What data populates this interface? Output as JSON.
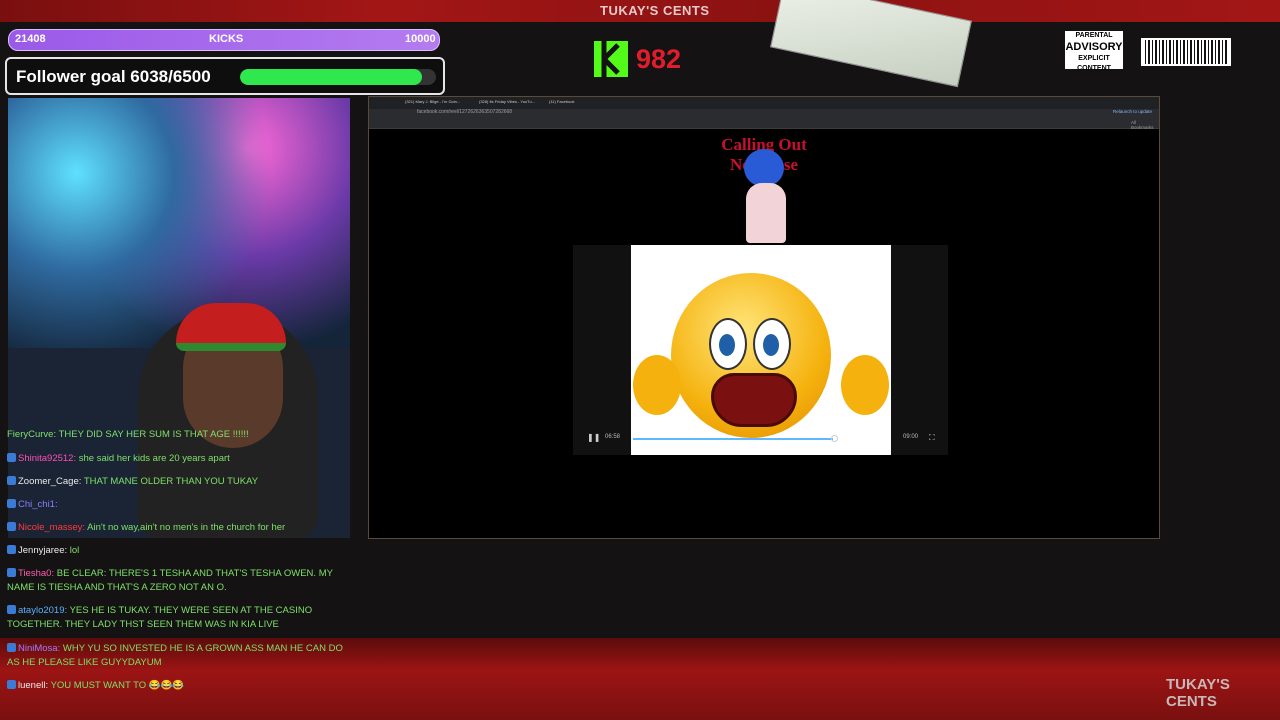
{
  "branding": {
    "top_title": "TUKAY'S CENTS",
    "bottom_title": "TUKAY'S CENTS"
  },
  "kicks_bar": {
    "left_value": "21408",
    "label": "KICKS",
    "right_value": "10000"
  },
  "follower_goal": {
    "text": "Follower goal 6038/6500",
    "progress_fraction": 0.929
  },
  "kick_counter": {
    "count": "982",
    "accent": "#53fc18",
    "count_color": "#e11d2b"
  },
  "advisory": {
    "line1": "PARENTAL",
    "line2": "ADVISORY",
    "line3": "EXPLICIT CONTENT"
  },
  "browser": {
    "tabs": [
      "(321) Mary J. Blige - I'm Goin...",
      "(328) Its Friday Vibes - YouTu...",
      "(11) Facebook"
    ],
    "url": "facebook.com/reel/1272626363507282668",
    "bookmarks_label": "All Bookmarks",
    "update_label": "Relaunch to update"
  },
  "video": {
    "time_current": "06:58",
    "time_total": "09:00",
    "overlay_title": "Calling Out Nonsense"
  },
  "chat": [
    {
      "user": "FieryCurve",
      "user_color": "#7ee06a",
      "text": "THEY DID SAY HER SUM IS THAT AGE !!!!!!",
      "text_color": "#7ee06a"
    },
    {
      "user": "Shinita92512",
      "user_color": "#ff4fb8",
      "text": "she said her kids are 20 years apart",
      "text_color": "#7ee06a"
    },
    {
      "user": "Zoomer_Cage",
      "user_color": "#eaeaea",
      "text": "THAT MANE OLDER THAN YOU TUKAY",
      "text_color": "#7ee06a"
    },
    {
      "user": "Chi_chi1",
      "user_color": "#8a7dff",
      "text": "",
      "text_color": "#eaeaea"
    },
    {
      "user": "Nicole_massey",
      "user_color": "#ff3b3b",
      "text": "Ain't no way,ain't no men's in the church for her",
      "text_color": "#7ee06a"
    },
    {
      "user": "Jennyjaree",
      "user_color": "#eaeaea",
      "text": "lol",
      "text_color": "#7ee06a"
    },
    {
      "user": "Tiesha0",
      "user_color": "#ff5fb0",
      "text": "BE CLEAR: THERE'S 1 TESHA AND THAT'S TESHA OWEN. MY NAME IS TIESHA AND THAT'S A ZERO NOT AN O.",
      "text_color": "#7ee06a"
    },
    {
      "user": "ataylo2019",
      "user_color": "#5ab0ff",
      "text": "YES HE IS TUKAY. THEY WERE SEEN AT THE CASINO TOGETHER. THEY LADY THST SEEN THEM WAS IN KIA LIVE",
      "text_color": "#7ee06a"
    },
    {
      "user": "NiniMosa",
      "user_color": "#9d7dff",
      "text": "WHY YU SO INVESTED HE IS A GROWN ASS MAN HE CAN DO AS HE PLEASE LIKE GUYYDAYUM",
      "text_color": "#7ee06a"
    },
    {
      "user": "luenell",
      "user_color": "#eaeaea",
      "text": "YOU MUST WANT TO 😂😂😂",
      "text_color": "#7ee06a"
    }
  ]
}
